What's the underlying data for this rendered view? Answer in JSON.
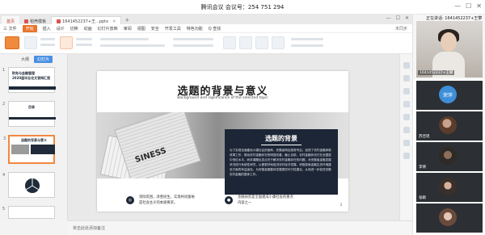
{
  "meeting": {
    "title": "腾讯会议 会议号：254 751 294"
  },
  "app": {
    "tabs": [
      {
        "label": "首页"
      },
      {
        "label": "稻壳模板"
      },
      {
        "label": "1641452237+王...pptx"
      },
      {
        "label": "+"
      }
    ],
    "menu": [
      "三 文件",
      "开始",
      "插入",
      "设计",
      "切换",
      "动画",
      "幻灯片放映",
      "审阅",
      "视图",
      "安全",
      "开发工具",
      "特色功能",
      "Q 查找"
    ],
    "menu_right": "未同步",
    "left_tabs": [
      "大纲",
      "幻灯片"
    ],
    "thumbnails": [
      {
        "num": "1",
        "title": "财务与金融管理",
        "sub": "2020届毕业论文答辩汇报"
      },
      {
        "num": "2",
        "title": "目录",
        "sub": ""
      },
      {
        "num": "3",
        "title": "选题的背景与意义",
        "sub": ""
      },
      {
        "num": "4",
        "title": "",
        "sub": ""
      },
      {
        "num": "5",
        "title": "",
        "sub": ""
      }
    ],
    "status": "单击此处添加备注"
  },
  "slide": {
    "title": "选题的背景与意义",
    "subtitle": "Background and significance of the selected topic",
    "paper_word": "SINESS",
    "box_heading": "选题的背景",
    "box_paragraph": "为了实现全面建设小康社会的使命，安徽省响应政府号召，加快了农村金融体制改革工作，推动农村金融状况的明显改善，截止目前，农村金融状况已在全国居中低位水平，而本课题出发点在于解决农村金融存在的问题，对安徽省金融发展状况进行系统性研究，以便更好地促进农村经济发展，积极探索金融生态环境建设方面的有益途径，为安徽金融整体发展提供可行性建议，从而进一步促进安徽农村金融的整体工作。",
    "item_left": "消除贫困，改善民生，实现共同富裕是社会主义的本质要求。",
    "item_right": "金融扶贫是全面建成小康社会的重点内容之一",
    "page_num": "3"
  },
  "side": {
    "speaking_label": "正在讲话: 1641452237+王攀",
    "speaker_name": "1641452237+王攀",
    "participants": [
      {
        "name": "荣萍",
        "avatar_text": "荣萍"
      },
      {
        "name": "苏佳瑶",
        "avatar_text": ""
      },
      {
        "name": "李倩",
        "avatar_text": ""
      },
      {
        "name": "张颖",
        "avatar_text": ""
      },
      {
        "name": "",
        "avatar_text": ""
      }
    ]
  },
  "colors": {
    "accent": "#e8742b",
    "slide_dark": "#1c2636",
    "selection": "#f0883e"
  }
}
